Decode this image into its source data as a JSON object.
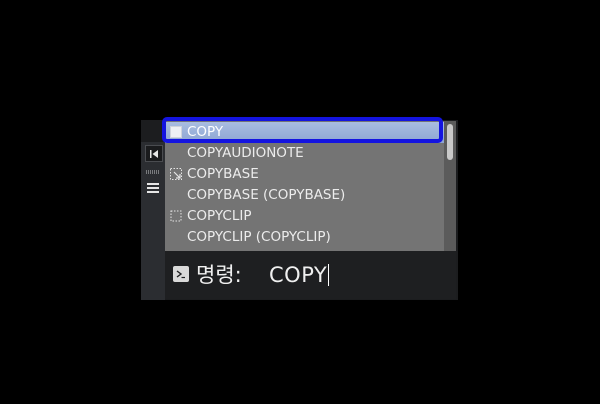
{
  "autocomplete": {
    "items": [
      {
        "label": "COPY",
        "icon": "copy-icon",
        "selected": true
      },
      {
        "label": "COPYAUDIONOTE",
        "icon": "",
        "selected": false
      },
      {
        "label": "COPYBASE",
        "icon": "copybase-icon",
        "selected": false
      },
      {
        "label": "COPYBASE (COPYBASE)",
        "icon": "",
        "selected": false
      },
      {
        "label": "COPYCLIP",
        "icon": "copyclip-icon",
        "selected": false
      },
      {
        "label": "COPYCLIP (COPYCLIP)",
        "icon": "",
        "selected": false
      }
    ]
  },
  "command_line": {
    "prompt_label": "명령:",
    "input_value": "COPY"
  },
  "colors": {
    "selection_highlight": "#1414e0",
    "list_background": "#747474",
    "selected_row": "#9fb4dc"
  }
}
